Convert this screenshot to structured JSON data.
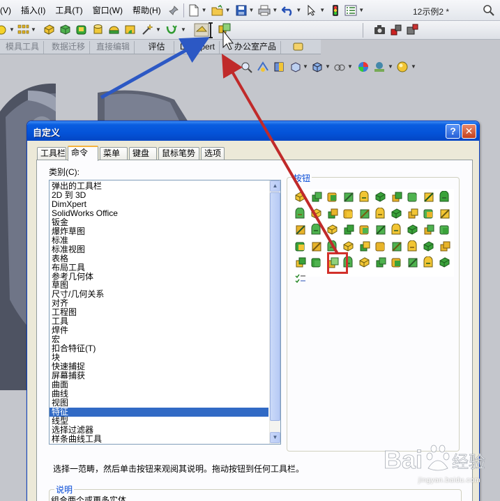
{
  "menubar": {
    "items": [
      "(V)",
      "插入(I)",
      "工具(T)",
      "窗口(W)",
      "帮助(H)"
    ],
    "doc_title": "12示例2 *"
  },
  "command_tabs": [
    "模具工具",
    "数据迁移",
    "直接编辑",
    "评估",
    "DimXpert",
    "办公室产品"
  ],
  "dialog": {
    "title": "自定义",
    "help_label": "?",
    "close_label": "✕",
    "tabs": [
      "工具栏",
      "命令",
      "菜单",
      "键盘",
      "鼠标笔势",
      "选项"
    ],
    "active_tab": "命令",
    "category_label": "类别(C):",
    "categories": [
      "弹出的工具栏",
      "2D 到 3D",
      "DimXpert",
      "SolidWorks Office",
      "钣金",
      "爆炸草图",
      "标准",
      "标准视图",
      "表格",
      "布局工具",
      "参考几何体",
      "草图",
      "尺寸/几何关系",
      "对齐",
      "工程图",
      "工具",
      "焊件",
      "宏",
      "扣合特征(T)",
      "块",
      "快速捕捉",
      "屏幕捕获",
      "曲面",
      "曲线",
      "视图",
      "特征",
      "线型",
      "选择过滤器",
      "样条曲线工具"
    ],
    "selected_category": "特征",
    "buttons_group_label": "按钮",
    "instructions": "选择一范畴，然后单击按钮来观阅其说明。拖动按钮到任何工具栏。",
    "description_label": "说明",
    "description_text": "组合两个或更多实体。"
  },
  "watermark": {
    "brand": "Bai",
    "suffix": "经验",
    "url": "jingyan.baidu.com"
  },
  "colors": {
    "title_bar": "#0453d8",
    "selection": "#316ac5",
    "highlight_box": "#d2302a",
    "arrow_blue": "#2c58c4",
    "arrow_red": "#c02a2a",
    "group_label": "#0046d5"
  }
}
